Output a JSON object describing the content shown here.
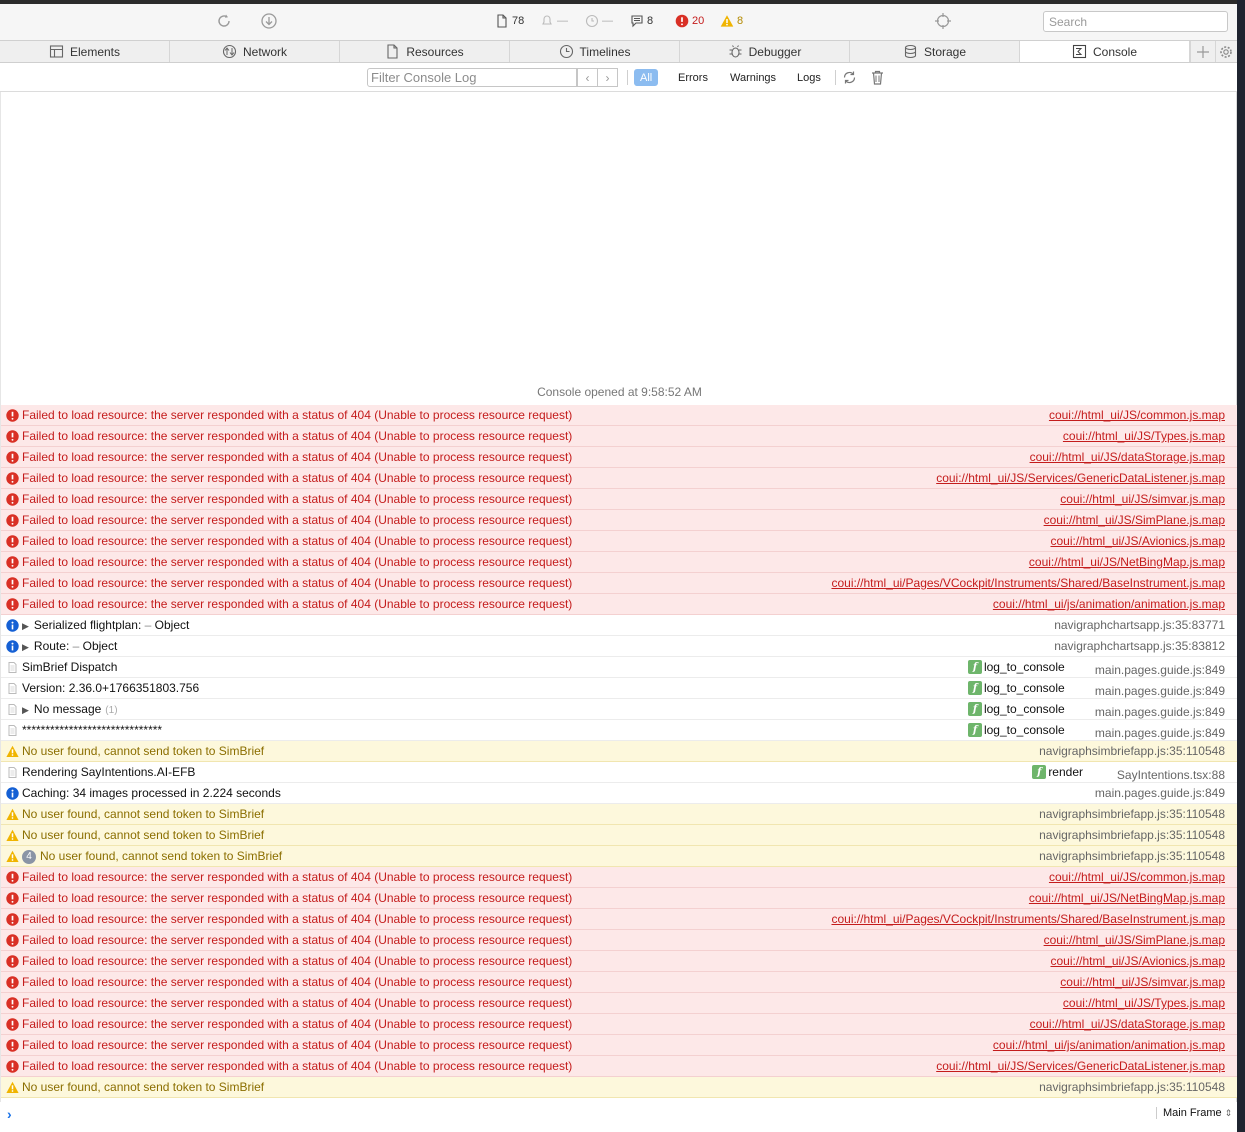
{
  "toolbar": {
    "stats": {
      "resources": "78",
      "leaks": "—",
      "timers": "—",
      "logs": "8",
      "errors": "20",
      "warnings": "8"
    },
    "search_placeholder": "Search"
  },
  "tabs": [
    {
      "label": "Elements",
      "icon": "elements-icon"
    },
    {
      "label": "Network",
      "icon": "network-icon"
    },
    {
      "label": "Resources",
      "icon": "resources-icon"
    },
    {
      "label": "Timelines",
      "icon": "timelines-icon"
    },
    {
      "label": "Debugger",
      "icon": "debugger-icon"
    },
    {
      "label": "Storage",
      "icon": "storage-icon"
    },
    {
      "label": "Console",
      "icon": "console-icon",
      "active": true
    }
  ],
  "filterbar": {
    "placeholder": "Filter Console Log",
    "scopes": [
      "All",
      "Errors",
      "Warnings",
      "Logs"
    ],
    "active_scope": "All"
  },
  "console": {
    "opened_text": "Console opened at 9:58:52 AM",
    "messages": [
      {
        "level": "error",
        "text": "Failed to load resource: the server responded with a status of 404 (Unable to process resource request)",
        "source": "coui://html_ui/JS/common.js.map"
      },
      {
        "level": "error",
        "text": "Failed to load resource: the server responded with a status of 404 (Unable to process resource request)",
        "source": "coui://html_ui/JS/Types.js.map"
      },
      {
        "level": "error",
        "text": "Failed to load resource: the server responded with a status of 404 (Unable to process resource request)",
        "source": "coui://html_ui/JS/dataStorage.js.map"
      },
      {
        "level": "error",
        "text": "Failed to load resource: the server responded with a status of 404 (Unable to process resource request)",
        "source": "coui://html_ui/JS/Services/GenericDataListener.js.map"
      },
      {
        "level": "error",
        "text": "Failed to load resource: the server responded with a status of 404 (Unable to process resource request)",
        "source": "coui://html_ui/JS/simvar.js.map"
      },
      {
        "level": "error",
        "text": "Failed to load resource: the server responded with a status of 404 (Unable to process resource request)",
        "source": "coui://html_ui/JS/SimPlane.js.map"
      },
      {
        "level": "error",
        "text": "Failed to load resource: the server responded with a status of 404 (Unable to process resource request)",
        "source": "coui://html_ui/JS/Avionics.js.map"
      },
      {
        "level": "error",
        "text": "Failed to load resource: the server responded with a status of 404 (Unable to process resource request)",
        "source": "coui://html_ui/JS/NetBingMap.js.map"
      },
      {
        "level": "error",
        "text": "Failed to load resource: the server responded with a status of 404 (Unable to process resource request)",
        "source": "coui://html_ui/Pages/VCockpit/Instruments/Shared/BaseInstrument.js.map"
      },
      {
        "level": "error",
        "text": "Failed to load resource: the server responded with a status of 404 (Unable to process resource request)",
        "source": "coui://html_ui/js/animation/animation.js.map"
      },
      {
        "level": "info",
        "expandable": true,
        "text": "Serialized flightplan:",
        "dash": "–",
        "obj": "Object",
        "source": "navigraphchartsapp.js:35:83771"
      },
      {
        "level": "info",
        "expandable": true,
        "text": "Route:",
        "dash": "–",
        "obj": "Object",
        "source": "navigraphchartsapp.js:35:83812"
      },
      {
        "level": "log",
        "text": "SimBrief Dispatch",
        "fn": "log_to_console",
        "source": "main.pages.guide.js:849"
      },
      {
        "level": "log",
        "text": "Version: 2.36.0+1766351803.756",
        "fn": "log_to_console",
        "source": "main.pages.guide.js:849"
      },
      {
        "level": "log",
        "expandable": true,
        "text": "No message",
        "repeat": "(1)",
        "fn": "log_to_console",
        "source": "main.pages.guide.js:849"
      },
      {
        "level": "log",
        "text": "******************************",
        "fn": "log_to_console",
        "source": "main.pages.guide.js:849"
      },
      {
        "level": "warn",
        "text": "No user found, cannot send token to SimBrief",
        "source": "navigraphsimbriefapp.js:35:110548"
      },
      {
        "level": "log",
        "text": "Rendering SayIntentions.AI-EFB",
        "fn": "render",
        "source": "SayIntentions.tsx:88"
      },
      {
        "level": "info",
        "text": "Caching: 34 images processed in 2.224 seconds",
        "source": "main.pages.guide.js:849"
      },
      {
        "level": "warn",
        "text": "No user found, cannot send token to SimBrief",
        "source": "navigraphsimbriefapp.js:35:110548"
      },
      {
        "level": "warn",
        "text": "No user found, cannot send token to SimBrief",
        "source": "navigraphsimbriefapp.js:35:110548"
      },
      {
        "level": "warn",
        "count": "4",
        "text": "No user found, cannot send token to SimBrief",
        "source": "navigraphsimbriefapp.js:35:110548"
      },
      {
        "level": "error",
        "text": "Failed to load resource: the server responded with a status of 404 (Unable to process resource request)",
        "source": "coui://html_ui/JS/common.js.map"
      },
      {
        "level": "error",
        "text": "Failed to load resource: the server responded with a status of 404 (Unable to process resource request)",
        "source": "coui://html_ui/JS/NetBingMap.js.map"
      },
      {
        "level": "error",
        "text": "Failed to load resource: the server responded with a status of 404 (Unable to process resource request)",
        "source": "coui://html_ui/Pages/VCockpit/Instruments/Shared/BaseInstrument.js.map"
      },
      {
        "level": "error",
        "text": "Failed to load resource: the server responded with a status of 404 (Unable to process resource request)",
        "source": "coui://html_ui/JS/SimPlane.js.map"
      },
      {
        "level": "error",
        "text": "Failed to load resource: the server responded with a status of 404 (Unable to process resource request)",
        "source": "coui://html_ui/JS/Avionics.js.map"
      },
      {
        "level": "error",
        "text": "Failed to load resource: the server responded with a status of 404 (Unable to process resource request)",
        "source": "coui://html_ui/JS/simvar.js.map"
      },
      {
        "level": "error",
        "text": "Failed to load resource: the server responded with a status of 404 (Unable to process resource request)",
        "source": "coui://html_ui/JS/Types.js.map"
      },
      {
        "level": "error",
        "text": "Failed to load resource: the server responded with a status of 404 (Unable to process resource request)",
        "source": "coui://html_ui/JS/dataStorage.js.map"
      },
      {
        "level": "error",
        "text": "Failed to load resource: the server responded with a status of 404 (Unable to process resource request)",
        "source": "coui://html_ui/js/animation/animation.js.map"
      },
      {
        "level": "error",
        "text": "Failed to load resource: the server responded with a status of 404 (Unable to process resource request)",
        "source": "coui://html_ui/JS/Services/GenericDataListener.js.map"
      },
      {
        "level": "warn",
        "text": "No user found, cannot send token to SimBrief",
        "source": "navigraphsimbriefapp.js:35:110548"
      }
    ]
  },
  "prompt": {
    "frame_label": "Main Frame"
  },
  "colors": {
    "error_bg": "#fde8e8",
    "error_text": "#c41c1c",
    "warn_bg": "#fdf8dc",
    "warn_text": "#8b6e00",
    "accent": "#8cbcf0"
  }
}
